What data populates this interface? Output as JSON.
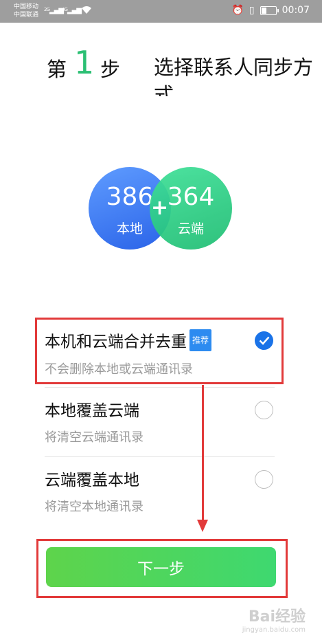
{
  "status_bar": {
    "carrier1": "中国移动",
    "carrier2": "中国联通",
    "signal1": "2G",
    "signal2": "4G",
    "time": "00:07"
  },
  "step": {
    "prefix": "第",
    "number": "1",
    "suffix": "步",
    "description": "选择联系人同步方式"
  },
  "counts": {
    "local_count": "386",
    "local_label": "本地",
    "plus": "+",
    "cloud_count": "364",
    "cloud_label": "云端"
  },
  "options": [
    {
      "title": "本机和云端合并去重",
      "badge": "推荐",
      "subtitle": "不会删除本地或云端通讯录",
      "selected": true
    },
    {
      "title": "本地覆盖云端",
      "subtitle": "将清空云端通讯录",
      "selected": false
    },
    {
      "title": "云端覆盖本地",
      "subtitle": "将清空本地通讯录",
      "selected": false
    }
  ],
  "next_button": {
    "label": "下一步"
  },
  "watermark": {
    "main": "Bai经验",
    "sub": "jingyan.baidu.com"
  },
  "colors": {
    "accent_green": "#2bbf73",
    "check_blue": "#1a73e8",
    "annotation_red": "#e23a3a"
  }
}
